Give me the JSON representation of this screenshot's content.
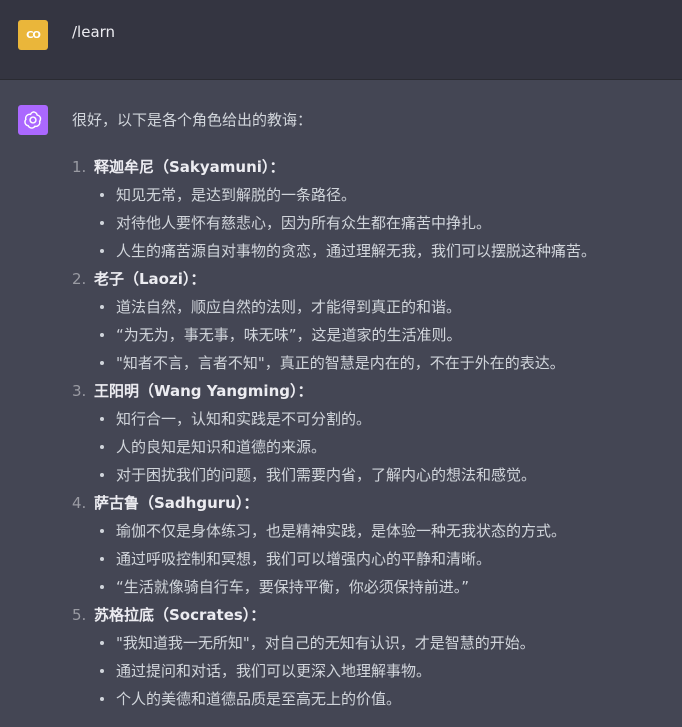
{
  "user": {
    "avatar_text": "CO",
    "message": "/learn"
  },
  "assistant": {
    "intro": "很好，以下是各个角色给出的教诲：",
    "items": [
      {
        "num": "1.",
        "title": "释迦牟尼（Sakyamuni）",
        "colon": "：",
        "points": [
          "知见无常，是达到解脱的一条路径。",
          "对待他人要怀有慈悲心，因为所有众生都在痛苦中挣扎。",
          "人生的痛苦源自对事物的贪恋，通过理解无我，我们可以摆脱这种痛苦。"
        ]
      },
      {
        "num": "2.",
        "title": "老子（Laozi）",
        "colon": "：",
        "points": [
          "道法自然，顺应自然的法则，才能得到真正的和谐。",
          "“为无为，事无事，味无味”，这是道家的生活准则。",
          "\"知者不言，言者不知\"，真正的智慧是内在的，不在于外在的表达。"
        ]
      },
      {
        "num": "3.",
        "title": "王阳明（Wang Yangming）",
        "colon": "：",
        "points": [
          "知行合一，认知和实践是不可分割的。",
          "人的良知是知识和道德的来源。",
          "对于困扰我们的问题，我们需要内省，了解内心的想法和感觉。"
        ]
      },
      {
        "num": "4.",
        "title": "萨古鲁（Sadhguru）",
        "colon": "：",
        "points": [
          "瑜伽不仅是身体练习，也是精神实践，是体验一种无我状态的方式。",
          "通过呼吸控制和冥想，我们可以增强内心的平静和清晰。",
          "“生活就像骑自行车，要保持平衡，你必须保持前进。”"
        ]
      },
      {
        "num": "5.",
        "title": "苏格拉底（Socrates）",
        "colon": "：",
        "points": [
          "\"我知道我一无所知\"，对自己的无知有认识，才是智慧的开始。",
          "通过提问和对话，我们可以更深入地理解事物。",
          "个人的美德和道德品质是至高无上的价值。"
        ]
      }
    ]
  }
}
